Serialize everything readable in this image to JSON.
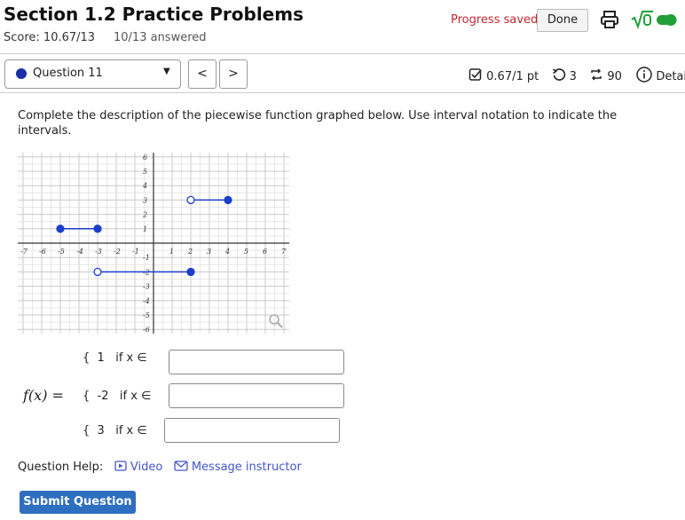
{
  "header": {
    "title": "Section 1.2 Practice Problems",
    "score": "Score: 10.67/13",
    "answered": "10/13 answered",
    "progress_saved": "Progress saved",
    "done_label": "Done"
  },
  "question_nav": {
    "selected": "Question 11",
    "prev": "<",
    "next": ">"
  },
  "meta": {
    "points": "0.67/1 pt",
    "retries": "3",
    "submissions": "90",
    "details": "Details"
  },
  "instructions": "Complete the description of the piecewise function graphed below. Use interval notation to indicate the intervals.",
  "graph": {
    "x_ticks": [
      "-7",
      "-6",
      "-5",
      "-4",
      "-3",
      "-2",
      "-1",
      "1",
      "2",
      "3",
      "4",
      "5",
      "6",
      "7"
    ],
    "y_ticks": [
      "6",
      "5",
      "4",
      "3",
      "2",
      "1",
      "-1",
      "-2",
      "-3",
      "-4",
      "-5",
      "-6"
    ],
    "segments": [
      {
        "x1": -5,
        "x2": -3,
        "y": 1,
        "left_closed": true,
        "right_closed": true
      },
      {
        "x1": -3,
        "x2": 2,
        "y": -2,
        "left_closed": false,
        "right_closed": true
      },
      {
        "x1": 2,
        "x2": 4,
        "y": 3,
        "left_closed": false,
        "right_closed": true
      }
    ],
    "line_color": "#1a3fcc"
  },
  "piecewise": {
    "lhs": "f(x) =",
    "rows": [
      {
        "brace": "{",
        "value": "1",
        "cond": "if x ∈",
        "answer": ""
      },
      {
        "brace": "{",
        "value": "-2",
        "cond": "if x ∈",
        "answer": ""
      },
      {
        "brace": "{",
        "value": "3",
        "cond": "if x ∈",
        "answer": ""
      }
    ]
  },
  "help": {
    "label": "Question Help:",
    "video": "Video",
    "message": "Message instructor"
  },
  "submit_label": "Submit Question",
  "colors": {
    "accent": "#2f6fc0",
    "progress": "#c0282d",
    "toggle": "#21a03a",
    "link": "#4455cc"
  }
}
